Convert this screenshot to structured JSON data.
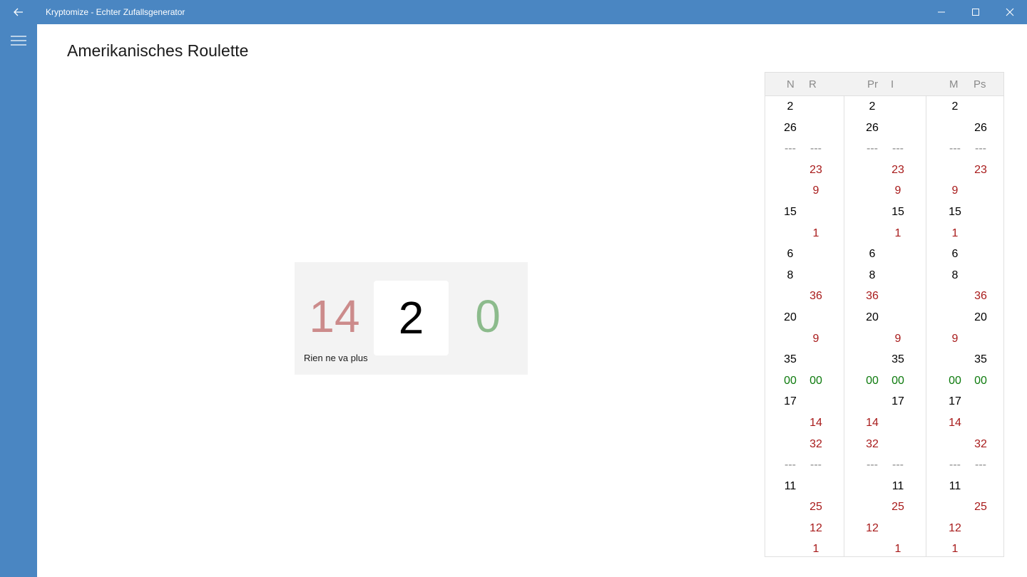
{
  "window": {
    "title": "Kryptomize - Echter Zufallsgenerator",
    "icons": {
      "back": "back-arrow-icon",
      "minimize": "minimize-icon",
      "maximize": "maximize-icon",
      "close": "close-icon",
      "menu": "hamburger-menu-icon"
    }
  },
  "page": {
    "title": "Amerikanisches Roulette"
  },
  "result": {
    "previous": "14",
    "current": "2",
    "next": "0",
    "status": "Rien ne va plus",
    "colors": {
      "previous": "#cc8b8b",
      "current": "#000000",
      "next": "#8cbb8c"
    }
  },
  "history": {
    "headers": [
      "N",
      "R",
      "Pr",
      "I",
      "M",
      "Ps"
    ],
    "colors": {
      "black": "#000000",
      "red": "#a81b1b",
      "green": "#0d7a0d",
      "separator": "#8a8a8a"
    },
    "rows": [
      [
        {
          "t": "2",
          "c": "black"
        },
        {
          "t": "",
          "c": ""
        },
        {
          "t": "2",
          "c": "black"
        },
        {
          "t": "",
          "c": ""
        },
        {
          "t": "2",
          "c": "black"
        },
        {
          "t": "",
          "c": ""
        }
      ],
      [
        {
          "t": "26",
          "c": "black"
        },
        {
          "t": "",
          "c": ""
        },
        {
          "t": "26",
          "c": "black"
        },
        {
          "t": "",
          "c": ""
        },
        {
          "t": "",
          "c": ""
        },
        {
          "t": "26",
          "c": "black"
        }
      ],
      [
        {
          "t": "---",
          "c": "dash"
        },
        {
          "t": "---",
          "c": "dash"
        },
        {
          "t": "---",
          "c": "dash"
        },
        {
          "t": "---",
          "c": "dash"
        },
        {
          "t": "---",
          "c": "dash"
        },
        {
          "t": "---",
          "c": "dash"
        }
      ],
      [
        {
          "t": "",
          "c": ""
        },
        {
          "t": "23",
          "c": "red"
        },
        {
          "t": "",
          "c": ""
        },
        {
          "t": "23",
          "c": "red"
        },
        {
          "t": "",
          "c": ""
        },
        {
          "t": "23",
          "c": "red"
        }
      ],
      [
        {
          "t": "",
          "c": ""
        },
        {
          "t": "9",
          "c": "red"
        },
        {
          "t": "",
          "c": ""
        },
        {
          "t": "9",
          "c": "red"
        },
        {
          "t": "9",
          "c": "red"
        },
        {
          "t": "",
          "c": ""
        }
      ],
      [
        {
          "t": "15",
          "c": "black"
        },
        {
          "t": "",
          "c": ""
        },
        {
          "t": "",
          "c": ""
        },
        {
          "t": "15",
          "c": "black"
        },
        {
          "t": "15",
          "c": "black"
        },
        {
          "t": "",
          "c": ""
        }
      ],
      [
        {
          "t": "",
          "c": ""
        },
        {
          "t": "1",
          "c": "red"
        },
        {
          "t": "",
          "c": ""
        },
        {
          "t": "1",
          "c": "red"
        },
        {
          "t": "1",
          "c": "red"
        },
        {
          "t": "",
          "c": ""
        }
      ],
      [
        {
          "t": "6",
          "c": "black"
        },
        {
          "t": "",
          "c": ""
        },
        {
          "t": "6",
          "c": "black"
        },
        {
          "t": "",
          "c": ""
        },
        {
          "t": "6",
          "c": "black"
        },
        {
          "t": "",
          "c": ""
        }
      ],
      [
        {
          "t": "8",
          "c": "black"
        },
        {
          "t": "",
          "c": ""
        },
        {
          "t": "8",
          "c": "black"
        },
        {
          "t": "",
          "c": ""
        },
        {
          "t": "8",
          "c": "black"
        },
        {
          "t": "",
          "c": ""
        }
      ],
      [
        {
          "t": "",
          "c": ""
        },
        {
          "t": "36",
          "c": "red"
        },
        {
          "t": "36",
          "c": "red"
        },
        {
          "t": "",
          "c": ""
        },
        {
          "t": "",
          "c": ""
        },
        {
          "t": "36",
          "c": "red"
        }
      ],
      [
        {
          "t": "20",
          "c": "black"
        },
        {
          "t": "",
          "c": ""
        },
        {
          "t": "20",
          "c": "black"
        },
        {
          "t": "",
          "c": ""
        },
        {
          "t": "",
          "c": ""
        },
        {
          "t": "20",
          "c": "black"
        }
      ],
      [
        {
          "t": "",
          "c": ""
        },
        {
          "t": "9",
          "c": "red"
        },
        {
          "t": "",
          "c": ""
        },
        {
          "t": "9",
          "c": "red"
        },
        {
          "t": "9",
          "c": "red"
        },
        {
          "t": "",
          "c": ""
        }
      ],
      [
        {
          "t": "35",
          "c": "black"
        },
        {
          "t": "",
          "c": ""
        },
        {
          "t": "",
          "c": ""
        },
        {
          "t": "35",
          "c": "black"
        },
        {
          "t": "",
          "c": ""
        },
        {
          "t": "35",
          "c": "black"
        }
      ],
      [
        {
          "t": "00",
          "c": "green"
        },
        {
          "t": "00",
          "c": "green"
        },
        {
          "t": "00",
          "c": "green"
        },
        {
          "t": "00",
          "c": "green"
        },
        {
          "t": "00",
          "c": "green"
        },
        {
          "t": "00",
          "c": "green"
        }
      ],
      [
        {
          "t": "17",
          "c": "black"
        },
        {
          "t": "",
          "c": ""
        },
        {
          "t": "",
          "c": ""
        },
        {
          "t": "17",
          "c": "black"
        },
        {
          "t": "17",
          "c": "black"
        },
        {
          "t": "",
          "c": ""
        }
      ],
      [
        {
          "t": "",
          "c": ""
        },
        {
          "t": "14",
          "c": "red"
        },
        {
          "t": "14",
          "c": "red"
        },
        {
          "t": "",
          "c": ""
        },
        {
          "t": "14",
          "c": "red"
        },
        {
          "t": "",
          "c": ""
        }
      ],
      [
        {
          "t": "",
          "c": ""
        },
        {
          "t": "32",
          "c": "red"
        },
        {
          "t": "32",
          "c": "red"
        },
        {
          "t": "",
          "c": ""
        },
        {
          "t": "",
          "c": ""
        },
        {
          "t": "32",
          "c": "red"
        }
      ],
      [
        {
          "t": "---",
          "c": "dash"
        },
        {
          "t": "---",
          "c": "dash"
        },
        {
          "t": "---",
          "c": "dash"
        },
        {
          "t": "---",
          "c": "dash"
        },
        {
          "t": "---",
          "c": "dash"
        },
        {
          "t": "---",
          "c": "dash"
        }
      ],
      [
        {
          "t": "11",
          "c": "black"
        },
        {
          "t": "",
          "c": ""
        },
        {
          "t": "",
          "c": ""
        },
        {
          "t": "11",
          "c": "black"
        },
        {
          "t": "11",
          "c": "black"
        },
        {
          "t": "",
          "c": ""
        }
      ],
      [
        {
          "t": "",
          "c": ""
        },
        {
          "t": "25",
          "c": "red"
        },
        {
          "t": "",
          "c": ""
        },
        {
          "t": "25",
          "c": "red"
        },
        {
          "t": "",
          "c": ""
        },
        {
          "t": "25",
          "c": "red"
        }
      ],
      [
        {
          "t": "",
          "c": ""
        },
        {
          "t": "12",
          "c": "red"
        },
        {
          "t": "12",
          "c": "red"
        },
        {
          "t": "",
          "c": ""
        },
        {
          "t": "12",
          "c": "red"
        },
        {
          "t": "",
          "c": ""
        }
      ],
      [
        {
          "t": "",
          "c": ""
        },
        {
          "t": "1",
          "c": "red"
        },
        {
          "t": "",
          "c": ""
        },
        {
          "t": "1",
          "c": "red"
        },
        {
          "t": "1",
          "c": "red"
        },
        {
          "t": "",
          "c": ""
        }
      ]
    ]
  }
}
